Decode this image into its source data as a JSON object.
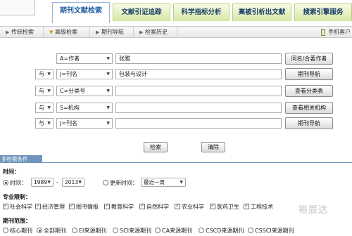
{
  "top_tabs": [
    {
      "label": "期刊文献检索",
      "active": true
    },
    {
      "label": "文献引证追踪",
      "active": false
    },
    {
      "label": "科学指标分析",
      "active": false
    },
    {
      "label": "高被引析出文献",
      "active": false
    },
    {
      "label": "搜索引擎服务",
      "active": false
    }
  ],
  "sub_tabs": [
    {
      "label": "传统检索",
      "active": false
    },
    {
      "label": "高级检索",
      "active": true
    },
    {
      "label": "期刊导航",
      "active": false
    },
    {
      "label": "检索历史",
      "active": false
    }
  ],
  "mobile_label": "手机客户",
  "search_rows": [
    {
      "logic": "",
      "field": "A=作者",
      "value": "张雅",
      "button": "同名/合著作者"
    },
    {
      "logic": "与",
      "field": "J=刊名",
      "value": "包装与设计",
      "button": "期刊导航"
    },
    {
      "logic": "与",
      "field": "C=分类号",
      "value": "",
      "button": "查看分类表"
    },
    {
      "logic": "与",
      "field": "S=机构",
      "value": "",
      "button": "查看相关机构"
    },
    {
      "logic": "与",
      "field": "J=刊名",
      "value": "",
      "button": "期刊导航"
    }
  ],
  "search_button": "检索",
  "reset_button": "清除",
  "conditions_title": "多检索条件",
  "time": {
    "label": "时间：",
    "option_range": "时间：",
    "from_year": "1989",
    "to_year": "2013",
    "separator": "-",
    "option_update": "更新时间：",
    "update_value": "最近一周"
  },
  "professional": {
    "label": "专业限制：",
    "items": [
      "社会科学",
      "经济管理",
      "图书情报",
      "教育科学",
      "自然科学",
      "农业科学",
      "医药卫生",
      "工程技术"
    ]
  },
  "journal_scope": {
    "label": "期刊范围：",
    "options": [
      "核心期刊",
      "全部期刊",
      "EI来源期刊",
      "SCI来源期刊",
      "CA来源期刊",
      "CSCD来源期刊",
      "CSSCI来源期刊"
    ],
    "selected_index": 1
  },
  "watermark": "裕辰达",
  "colors": {
    "accent": "#6f95bd",
    "tab_active_text": "#1f5f9e",
    "tab_green": "#d7e7a4"
  }
}
